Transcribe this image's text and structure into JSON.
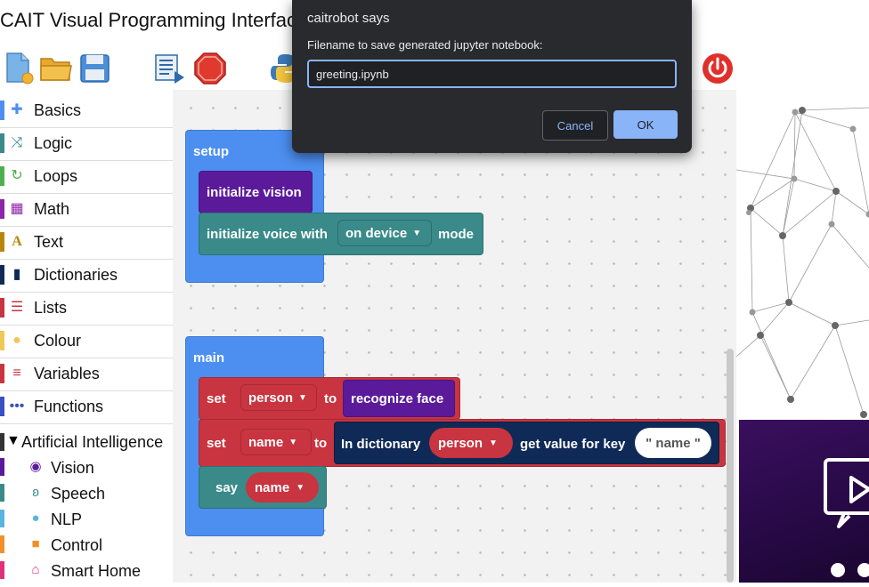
{
  "app": {
    "title": "CAIT Visual Programming Interface"
  },
  "toolbar": {
    "icons": [
      "new-file-icon",
      "open-folder-icon",
      "save-icon",
      "run-script-icon",
      "stop-icon",
      "python-icon",
      "power-icon"
    ]
  },
  "toolbox": {
    "categories": [
      {
        "label": "Basics",
        "icon": "puzzle-icon",
        "color": "#4c8ff0"
      },
      {
        "label": "Logic",
        "icon": "shuffle-icon",
        "color": "#3a8a8a"
      },
      {
        "label": "Loops",
        "icon": "loop-icon",
        "color": "#4caf50"
      },
      {
        "label": "Math",
        "icon": "calculator-icon",
        "color": "#8e24aa"
      },
      {
        "label": "Text",
        "icon": "font-icon",
        "color": "#b8860b"
      },
      {
        "label": "Dictionaries",
        "icon": "book-icon",
        "color": "#0f2a57"
      },
      {
        "label": "Lists",
        "icon": "list-icon",
        "color": "#c83440"
      },
      {
        "label": "Colour",
        "icon": "palette-icon",
        "color": "#f0c75a"
      },
      {
        "label": "Variables",
        "icon": "lines-icon",
        "color": "#c83440"
      },
      {
        "label": "Functions",
        "icon": "dots-icon",
        "color": "#3b4fc4"
      }
    ],
    "ai": {
      "label": "Artificial Intelligence",
      "children": [
        {
          "label": "Vision",
          "icon": "eye-icon",
          "color": "#5b1a9a"
        },
        {
          "label": "Speech",
          "icon": "ear-icon",
          "color": "#3a8a8a"
        },
        {
          "label": "NLP",
          "icon": "chat-icon",
          "color": "#5ab4e0"
        },
        {
          "label": "Control",
          "icon": "robot-icon",
          "color": "#f0902a"
        },
        {
          "label": "Smart Home",
          "icon": "home-icon",
          "color": "#e0307a"
        }
      ]
    }
  },
  "workspace": {
    "setup": {
      "label": "setup",
      "init_vision": "initialize vision",
      "init_voice": "initialize voice with",
      "voice_option": "on device",
      "mode": "mode"
    },
    "main": {
      "label": "main",
      "set1": "set",
      "set1_var": "person",
      "to1": "to",
      "recognize": "recognize face",
      "set2": "set",
      "set2_var": "name",
      "to2": "to",
      "in_dict": "In dictionary",
      "dict_var": "person",
      "get_value": "get value for key",
      "key": "\" name \"",
      "say": "say",
      "say_var": "name"
    }
  },
  "dialog": {
    "title": "caitrobot says",
    "message": "Filename to save generated jupyter notebook:",
    "value": "greeting.ipynb",
    "cancel": "Cancel",
    "ok": "OK"
  }
}
